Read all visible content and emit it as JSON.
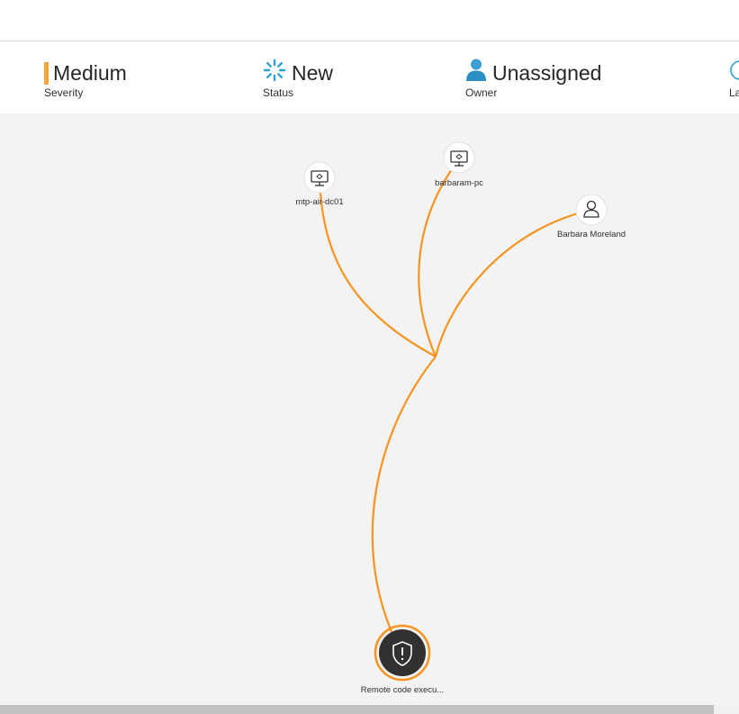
{
  "summary": {
    "severity": {
      "value": "Medium",
      "label": "Severity",
      "color": "#f7a53b"
    },
    "status": {
      "value": "New",
      "label": "Status",
      "color": "#2aa0d8"
    },
    "owner": {
      "value": "Unassigned",
      "label": "Owner",
      "color": "#2aa0d8"
    },
    "partial_label": "La"
  },
  "graph": {
    "edge_color": "#f7931e",
    "nodes": [
      {
        "id": "mtp-air-dc01",
        "label": "mtp-air-dc01",
        "icon": "device-icon"
      },
      {
        "id": "barbaram-pc",
        "label": "barbaram-pc",
        "icon": "device-icon"
      },
      {
        "id": "barbara-moreland",
        "label": "Barbara Moreland",
        "icon": "user-icon"
      },
      {
        "id": "alert",
        "label": "Remote code execu...",
        "icon": "shield-alert-icon"
      }
    ]
  }
}
